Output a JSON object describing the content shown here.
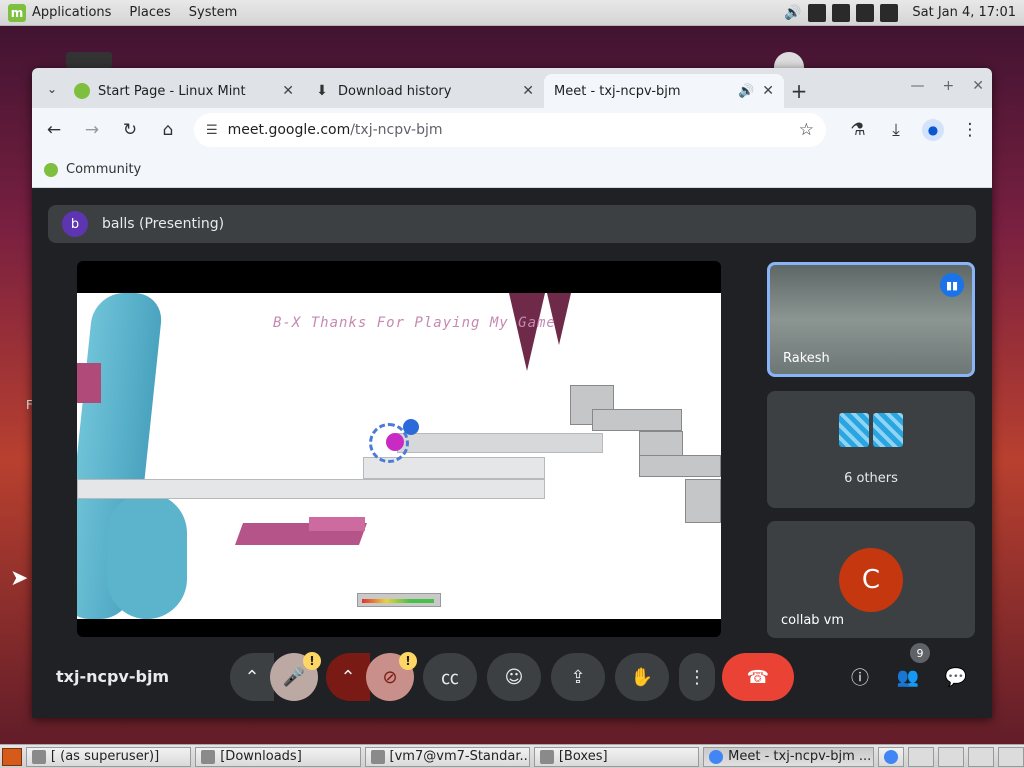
{
  "top_panel": {
    "menus": [
      "Applications",
      "Places",
      "System"
    ],
    "clock": "Sat Jan  4, 17:01"
  },
  "desktop": {
    "stray_letter": "F"
  },
  "browser": {
    "tabs": [
      {
        "label": "Start Page - Linux Mint",
        "icon": "mint-icon"
      },
      {
        "label": "Download history",
        "icon": "download-icon"
      },
      {
        "label": "Meet - txj-ncpv-bjm",
        "icon": "meet-icon",
        "active": true
      }
    ],
    "url_host": "meet.google.com",
    "url_path": "/txj-ncpv-bjm",
    "bookmark": "Community"
  },
  "meet": {
    "presenter_initial": "b",
    "presenting_label": "balls (Presenting)",
    "game_text": "B-X Thanks For Playing My Game",
    "tiles": [
      {
        "name": "Rakesh"
      },
      {
        "name": "6 others"
      },
      {
        "name": "collab vm",
        "initial": "C"
      }
    ],
    "meeting_code": "txj-ncpv-bjm",
    "participants_count": "9",
    "warning_glyph": "!",
    "colors": {
      "end_call": "#ea4335",
      "speaking": "#1a73e8",
      "avatar_c": "#c5370f"
    }
  },
  "taskbar": {
    "items": [
      {
        "label": "[ (as superuser)]"
      },
      {
        "label": "[Downloads]"
      },
      {
        "label": "[vm7@vm7-Standar..."
      },
      {
        "label": "[Boxes]"
      },
      {
        "label": "Meet - txj-ncpv-bjm ...",
        "active": true
      }
    ]
  }
}
